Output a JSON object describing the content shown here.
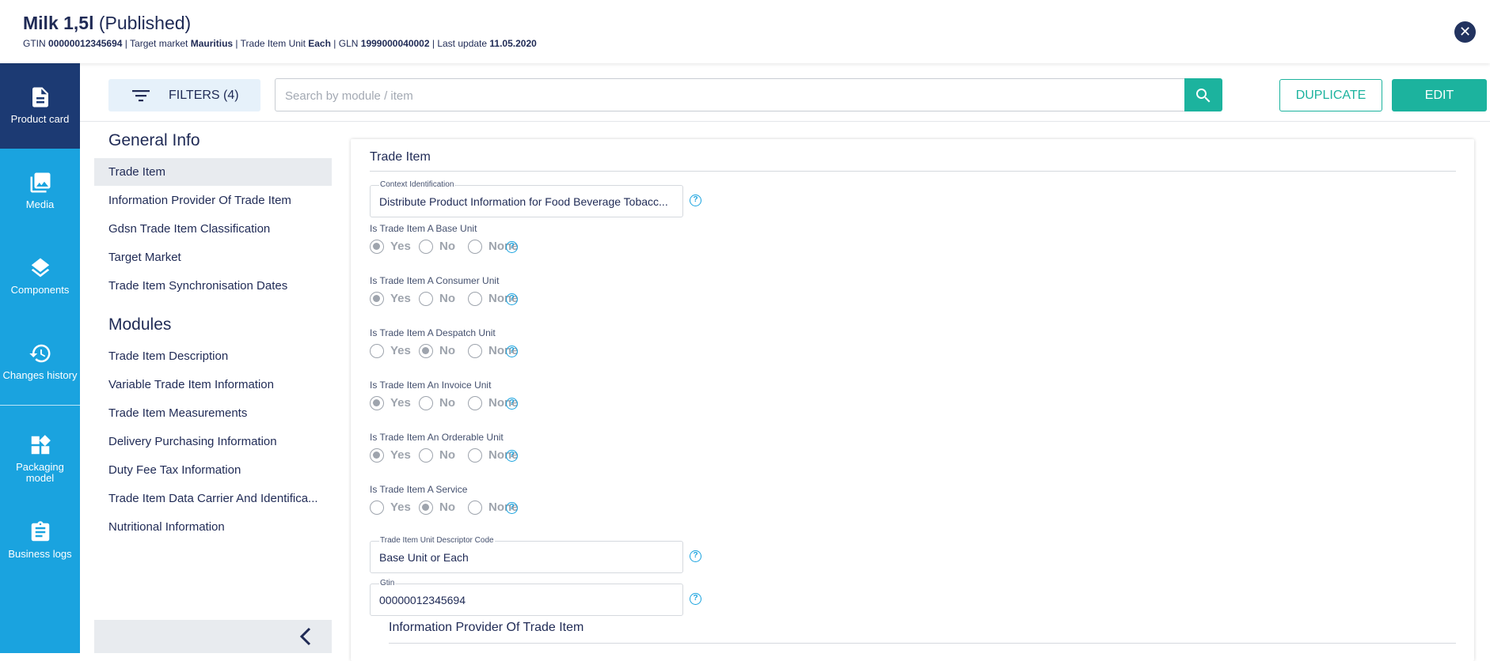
{
  "header": {
    "product_name": "Milk 1,5l",
    "status": "(Published)",
    "gtin_label": "GTIN",
    "gtin": "00000012345694",
    "target_market_label": "Target market",
    "target_market": "Mauritius",
    "unit_label": "Trade Item Unit",
    "unit": "Each",
    "gln_label": "GLN",
    "gln": "1999000040002",
    "last_update_label": "Last update",
    "last_update": "11.05.2020",
    "close_icon": "close-icon"
  },
  "sidebar": {
    "items": [
      {
        "label": "Product card",
        "icon": "document-icon",
        "active": true
      },
      {
        "label": "Media",
        "icon": "images-icon"
      },
      {
        "label": "Components",
        "icon": "layers-icon"
      },
      {
        "label": "Changes history",
        "icon": "history-icon"
      },
      {
        "label": "Packaging model",
        "icon": "widgets-icon"
      },
      {
        "label": "Business logs",
        "icon": "clipboard-icon"
      }
    ]
  },
  "toolbar": {
    "filters_label": "FILTERS (4)",
    "search_placeholder": "Search by module / item",
    "duplicate_label": "DUPLICATE",
    "edit_label": "EDIT"
  },
  "leftnav": {
    "general_title": "General Info",
    "general_items": [
      "Trade Item",
      "Information Provider Of Trade Item",
      "Gdsn Trade Item Classification",
      "Target Market",
      "Trade Item Synchronisation Dates"
    ],
    "modules_title": "Modules",
    "module_items": [
      "Trade Item Description",
      "Variable Trade Item Information",
      "Trade Item Measurements",
      "Delivery Purchasing Information",
      "Duty Fee Tax Information",
      "Trade Item Data Carrier And Identifica...",
      "Nutritional Information"
    ]
  },
  "main": {
    "card_title": "Trade Item",
    "context": {
      "label": "Context Identification",
      "value": "Distribute Product Information for Food Beverage Tobacc..."
    },
    "radio_options": [
      "Yes",
      "No",
      "None"
    ],
    "questions": [
      {
        "label": "Is Trade Item A Base Unit",
        "selected": "Yes"
      },
      {
        "label": "Is Trade Item A Consumer Unit",
        "selected": "Yes"
      },
      {
        "label": "Is Trade Item A Despatch Unit",
        "selected": "No"
      },
      {
        "label": "Is Trade Item An Invoice Unit",
        "selected": "Yes"
      },
      {
        "label": "Is Trade Item An Orderable Unit",
        "selected": "Yes"
      },
      {
        "label": "Is Trade Item A Service",
        "selected": "No"
      }
    ],
    "descriptor": {
      "label": "Trade Item Unit Descriptor Code",
      "value": "Base Unit or Each"
    },
    "gtin": {
      "label": "Gtin",
      "value": "00000012345694"
    },
    "subsection_title": "Information Provider Of Trade Item"
  },
  "colors": {
    "sidebar": "#1aa3df",
    "sidebar_active": "#1c3a73",
    "accent": "#1cb39e",
    "text": "#1f2a55"
  }
}
